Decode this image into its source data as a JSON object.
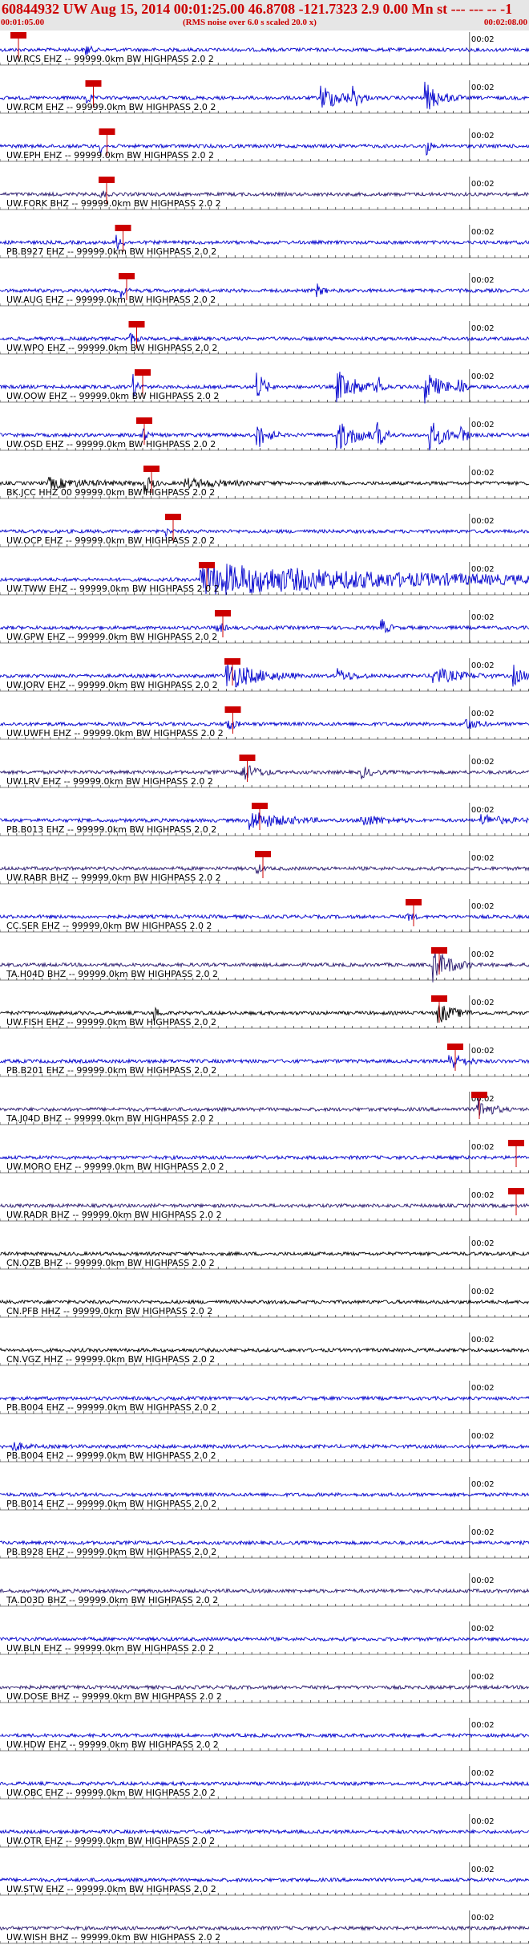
{
  "header": {
    "title": "60844932 UW Aug 15, 2014 00:01:25.00   46.8708 -121.7323  2.9 0.00 Mn st --- --- --  -1",
    "start_time": "00:01:05.00",
    "note": "(RMS noise over 6.0 s scaled 20.0 x)",
    "end_time": "00:02:08.00"
  },
  "chart_data": {
    "type": "line",
    "time_range": [
      "00:01:05.00",
      "00:02:08.00"
    ],
    "tick_interval_s": 1,
    "minute_mark_label": "00:02",
    "pick_label": "",
    "colors": {
      "trace_blue": "#0000cc",
      "trace_navy": "#2a1a6e",
      "trace_black": "#000000",
      "pick": "#cc0000",
      "header_bg": "#e6e6e6"
    },
    "traces": [
      {
        "label": "UW.RCS EHZ -- 99999.0km BW  HIGHPASS  2.0  2",
        "color": "blue",
        "pick_time_s": 15.0,
        "bursts": [
          [
            107,
            8,
            2.2
          ]
        ]
      },
      {
        "label": "UW.RCM EHZ -- 99999.0km BW  HIGHPASS  2.0  2",
        "color": "blue",
        "pick_time_s": 108.5,
        "bursts": [
          [
            108,
            6,
            3.0
          ],
          [
            400,
            40,
            4.0
          ],
          [
            440,
            14,
            4.0
          ],
          [
            530,
            30,
            4.5
          ]
        ]
      },
      {
        "label": "UW.EPH EHZ -- 99999.0km BW  HIGHPASS  2.0  2",
        "color": "blue",
        "pick_time_s": 125.5,
        "bursts": [
          [
            125,
            6,
            1.5
          ],
          [
            532,
            6,
            3.0
          ]
        ]
      },
      {
        "label": "UW.FORK BHZ -- 99999.0km BW  HIGHPASS  2.0  2",
        "color": "navy",
        "pick_time_s": 125.0,
        "bursts": [
          [
            125,
            8,
            1.5
          ]
        ]
      },
      {
        "label": "PB.B927 EHZ -- 99999.0km BW  HIGHPASS  2.0  2",
        "color": "blue",
        "pick_time_s": 145.5,
        "bursts": [
          [
            145,
            10,
            2.5
          ]
        ]
      },
      {
        "label": "UW.AUG EHZ -- 99999.0km BW  HIGHPASS  2.0  2",
        "color": "blue",
        "pick_time_s": 150.0,
        "bursts": [
          [
            150,
            8,
            2.0
          ],
          [
            395,
            12,
            1.8
          ]
        ]
      },
      {
        "label": "UW.WPO EHZ -- 99999.0km BW  HIGHPASS  2.0  2",
        "color": "blue",
        "pick_time_s": 162.5,
        "bursts": [
          [
            162,
            10,
            2.2
          ]
        ]
      },
      {
        "label": "UW.OOW EHZ -- 99999.0km BW  HIGHPASS  2.0  2",
        "color": "blue",
        "pick_time_s": 170.0,
        "bursts": [
          [
            165,
            10,
            3.5
          ],
          [
            320,
            15,
            5.0
          ],
          [
            420,
            40,
            5.0
          ],
          [
            470,
            10,
            4.5
          ],
          [
            530,
            30,
            5.0
          ],
          [
            572,
            10,
            4.0
          ]
        ]
      },
      {
        "label": "UW.OSD EHZ -- 99999.0km BW  HIGHPASS  2.0  2",
        "color": "blue",
        "pick_time_s": 172.0,
        "bursts": [
          [
            175,
            10,
            3.0
          ],
          [
            320,
            20,
            4.5
          ],
          [
            420,
            40,
            4.8
          ],
          [
            470,
            15,
            4.5
          ],
          [
            535,
            30,
            4.8
          ],
          [
            575,
            10,
            4.0
          ]
        ]
      },
      {
        "label": "BK.JCC HHZ 00 99999.0km BW  HIGHPASS  2.0  2",
        "color": "black",
        "pick_time_s": 181.0,
        "bursts": [
          [
            60,
            80,
            1.5
          ],
          [
            180,
            14,
            3.0
          ],
          [
            230,
            80,
            1.3
          ]
        ]
      },
      {
        "label": "UW.OCP EHZ -- 99999.0km BW  HIGHPASS  2.0  2",
        "color": "blue",
        "pick_time_s": 208.0,
        "bursts": [
          [
            207,
            5,
            1.5
          ]
        ]
      },
      {
        "label": "UW.TWW EHZ -- 99999.0km BW  HIGHPASS  2.0  2",
        "color": "blue",
        "pick_time_s": 250.0,
        "bursts": [
          [
            250,
            410,
            5.0
          ]
        ]
      },
      {
        "label": "UW.GPW EHZ -- 99999.0km BW  HIGHPASS  2.0  2",
        "color": "blue",
        "pick_time_s": 270.0,
        "bursts": [
          [
            270,
            10,
            2.5
          ],
          [
            475,
            12,
            3.0
          ]
        ]
      },
      {
        "label": "UW.JORV EHZ -- 99999.0km BW  HIGHPASS  2.0  2",
        "color": "blue",
        "pick_time_s": 282.0,
        "bursts": [
          [
            282,
            60,
            4.5
          ],
          [
            420,
            30,
            2.0
          ],
          [
            540,
            50,
            2.5
          ],
          [
            640,
            20,
            3.0
          ]
        ]
      },
      {
        "label": "UW.UWFH EHZ -- 99999.0km BW  HIGHPASS  2.0  2",
        "color": "blue",
        "pick_time_s": 282.5,
        "bursts": [
          [
            282,
            12,
            3.0
          ],
          [
            580,
            20,
            2.0
          ]
        ]
      },
      {
        "label": "UW.LRV EHZ -- 99999.0km BW  HIGHPASS  2.0  2",
        "color": "navy",
        "pick_time_s": 300.5,
        "bursts": [
          [
            300,
            30,
            3.0
          ],
          [
            450,
            20,
            1.8
          ]
        ]
      },
      {
        "label": "PB.B013 EHZ -- 99999.0km BW  HIGHPASS  2.0  2",
        "color": "blue",
        "pick_time_s": 316.0,
        "bursts": [
          [
            310,
            60,
            3.0
          ],
          [
            450,
            40,
            2.0
          ],
          [
            600,
            40,
            1.8
          ]
        ]
      },
      {
        "label": "UW.RABR BHZ -- 99999.0km BW  HIGHPASS  2.0  2",
        "color": "navy",
        "pick_time_s": 320.0,
        "bursts": [
          [
            320,
            10,
            1.5
          ]
        ]
      },
      {
        "label": "CC.SER EHZ -- 99999.0km BW  HIGHPASS  2.0  2",
        "color": "blue",
        "pick_time_s": 508.0,
        "bursts": [
          [
            508,
            10,
            1.5
          ]
        ]
      },
      {
        "label": "TA.H04D BHZ -- 99999.0km BW  HIGHPASS  2.0  2",
        "color": "navy",
        "pick_time_s": 540.0,
        "bursts": [
          [
            540,
            35,
            5.0
          ]
        ]
      },
      {
        "label": "UW.FISH EHZ -- 99999.0km BW  HIGHPASS  2.0  2",
        "color": "black",
        "pick_time_s": 540.0,
        "bursts": [
          [
            190,
            10,
            3.0
          ],
          [
            545,
            30,
            3.5
          ]
        ]
      },
      {
        "label": "PB.B201 EHZ -- 99999.0km BW  HIGHPASS  2.0  2",
        "color": "blue",
        "pick_time_s": 560.0,
        "bursts": [
          [
            560,
            25,
            3.0
          ]
        ]
      },
      {
        "label": "TA.J04D BHZ -- 99999.0km BW  HIGHPASS  2.0  2",
        "color": "navy",
        "pick_time_s": 590.0,
        "bursts": [
          [
            595,
            25,
            3.5
          ]
        ]
      },
      {
        "label": "UW.MORO EHZ -- 99999.0km BW  HIGHPASS  2.0  2",
        "color": "blue",
        "pick_time_s": 636.0,
        "bursts": []
      },
      {
        "label": "UW.RADR BHZ -- 99999.0km BW  HIGHPASS  2.0  2",
        "color": "navy",
        "pick_time_s": 636.0,
        "bursts": []
      },
      {
        "label": "CN.OZB BHZ -- 99999.0km BW  HIGHPASS  2.0  2",
        "color": "black",
        "pick_time_s": null,
        "bursts": []
      },
      {
        "label": "CN.PFB HHZ -- 99999.0km BW  HIGHPASS  2.0  2",
        "color": "black",
        "pick_time_s": null,
        "bursts": []
      },
      {
        "label": "CN.VGZ HHZ -- 99999.0km BW  HIGHPASS  2.0  2",
        "color": "black",
        "pick_time_s": null,
        "bursts": []
      },
      {
        "label": "PB.B004 EHZ -- 99999.0km BW  HIGHPASS  2.0  2",
        "color": "blue",
        "pick_time_s": null,
        "bursts": []
      },
      {
        "label": "PB.B004 EH2 -- 99999.0km BW  HIGHPASS  2.0  2",
        "color": "blue",
        "pick_time_s": null,
        "bursts": [
          [
            15,
            20,
            1.5
          ]
        ]
      },
      {
        "label": "PB.B014 EHZ -- 99999.0km BW  HIGHPASS  2.0  2",
        "color": "blue",
        "pick_time_s": null,
        "bursts": []
      },
      {
        "label": "PB.B928 EHZ -- 99999.0km BW  HIGHPASS  2.0  2",
        "color": "blue",
        "pick_time_s": null,
        "bursts": []
      },
      {
        "label": "TA.D03D BHZ -- 99999.0km BW  HIGHPASS  2.0  2",
        "color": "navy",
        "pick_time_s": null,
        "bursts": []
      },
      {
        "label": "UW.BLN EHZ -- 99999.0km BW  HIGHPASS  2.0  2",
        "color": "blue",
        "pick_time_s": null,
        "bursts": []
      },
      {
        "label": "UW.DOSE BHZ -- 99999.0km BW  HIGHPASS  2.0  2",
        "color": "navy",
        "pick_time_s": null,
        "bursts": []
      },
      {
        "label": "UW.HDW EHZ -- 99999.0km BW  HIGHPASS  2.0  2",
        "color": "blue",
        "pick_time_s": null,
        "bursts": []
      },
      {
        "label": "UW.OBC EHZ -- 99999.0km BW  HIGHPASS  2.0  2",
        "color": "blue",
        "pick_time_s": null,
        "bursts": []
      },
      {
        "label": "UW.OTR EHZ -- 99999.0km BW  HIGHPASS  2.0  2",
        "color": "blue",
        "pick_time_s": null,
        "bursts": []
      },
      {
        "label": "UW.STW EHZ -- 99999.0km BW  HIGHPASS  2.0  2",
        "color": "blue",
        "pick_time_s": null,
        "bursts": []
      },
      {
        "label": "UW.WISH BHZ -- 99999.0km BW  HIGHPASS  2.0  2",
        "color": "navy",
        "pick_time_s": null,
        "bursts": []
      }
    ]
  }
}
